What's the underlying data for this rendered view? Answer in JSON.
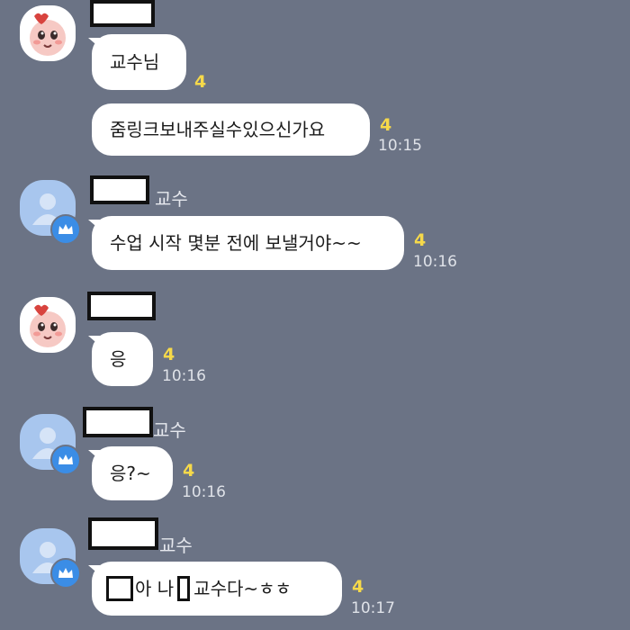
{
  "colors": {
    "background": "#6b7385",
    "bubble": "#ffffff",
    "unread": "#f6d94a",
    "crown_badge": "#3b8de6"
  },
  "messages": [
    {
      "text": "교수님",
      "unread": "4",
      "time": ""
    },
    {
      "text": "줌링크보내주실수있으신가요",
      "unread": "4",
      "time": "10:15"
    },
    {
      "sender_role": "교수",
      "text": "수업 시작 몇분 전에 보낼거야~~",
      "unread": "4",
      "time": "10:16"
    },
    {
      "text": "응",
      "unread": "4",
      "time": "10:16"
    },
    {
      "sender_role": "교수",
      "text": "응?~",
      "unread": "4",
      "time": "10:16"
    },
    {
      "sender_role": "교수",
      "text_part1": "아 나",
      "text_part2": "교수다~ㅎㅎ",
      "unread": "4",
      "time": "10:17"
    }
  ],
  "icons": {
    "peach_avatar": "peach-character-icon",
    "default_avatar": "default-profile-icon",
    "crown_badge": "crown-icon"
  }
}
